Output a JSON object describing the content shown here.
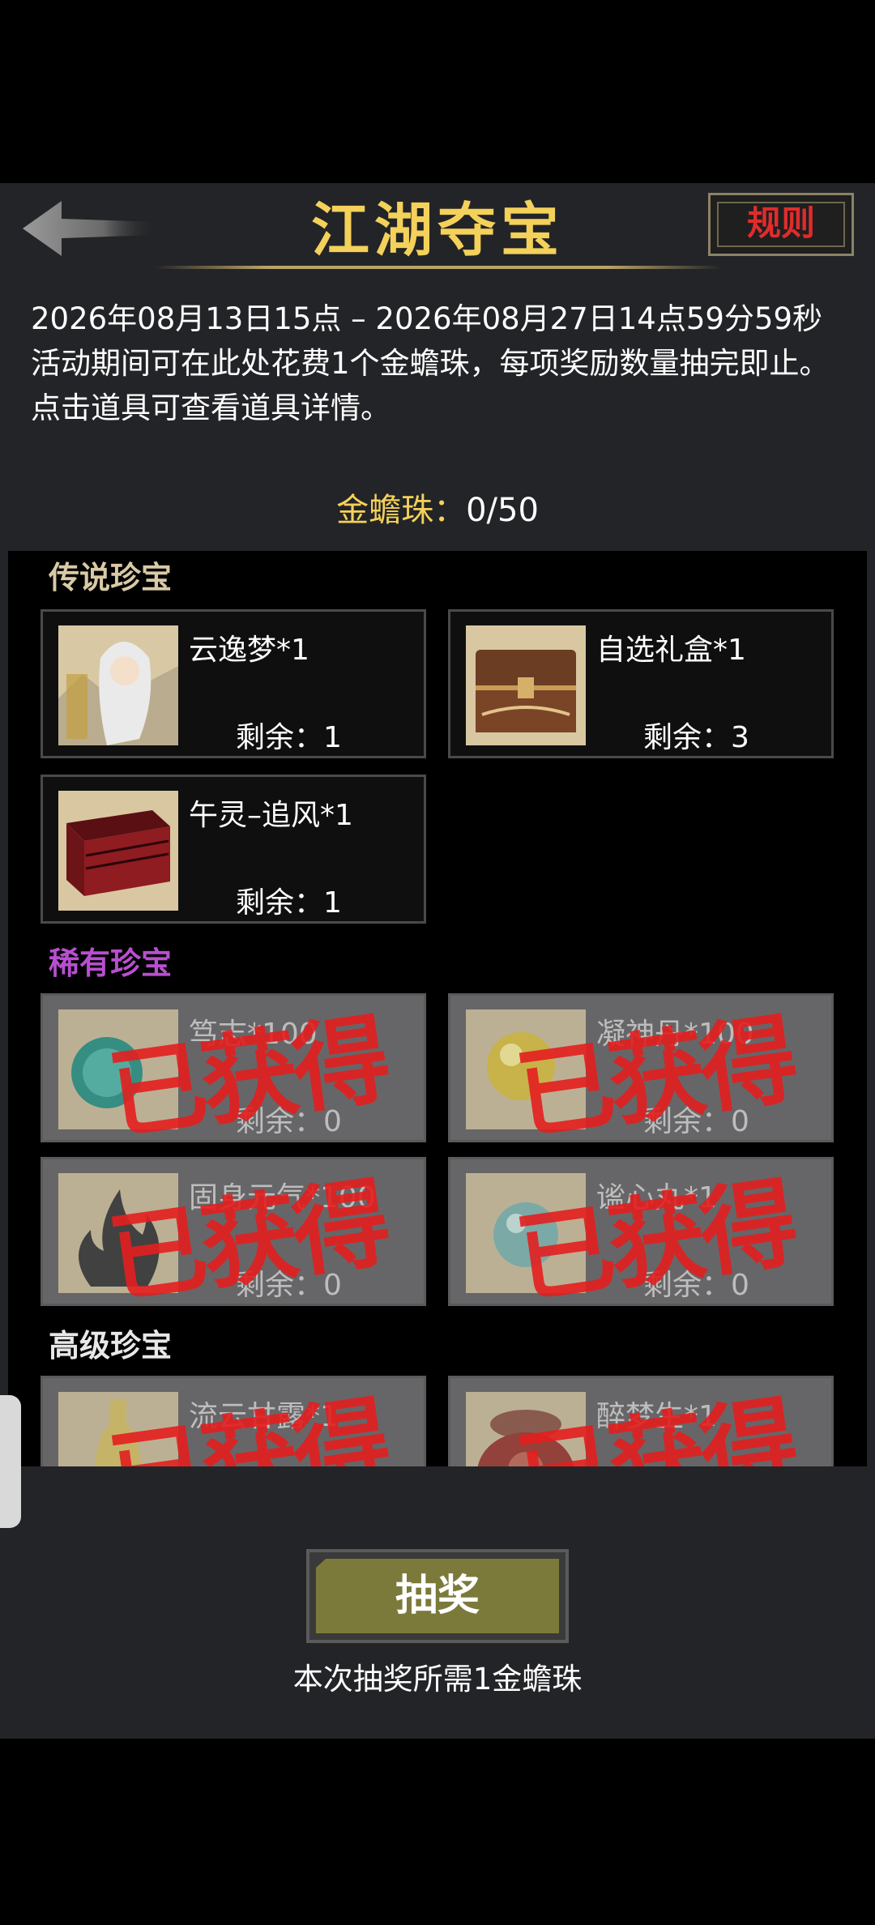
{
  "header": {
    "title": "江湖夺宝",
    "rules_label": "规则"
  },
  "description": {
    "period": "2026年08月13日15点 – 2026年08月27日14点59分59秒",
    "line2": "活动期间可在此处花费1个金蟾珠，每项奖励数量抽完即止。",
    "line3": "点击道具可查看道具详情。"
  },
  "currency": {
    "label": "金蟾珠：",
    "value": "0/50"
  },
  "sections": [
    {
      "title": "传说珍宝",
      "color": "#d9c9a6",
      "items": [
        {
          "name": "云逸梦*1",
          "remain": "剩余：1",
          "obtained": false,
          "icon": "character-portrait-icon"
        },
        {
          "name": "自选礼盒*1",
          "remain": "剩余：3",
          "obtained": false,
          "icon": "wooden-chest-icon"
        },
        {
          "name": "午灵–追风*1",
          "remain": "剩余：1",
          "obtained": false,
          "icon": "red-box-icon"
        }
      ]
    },
    {
      "title": "稀有珍宝",
      "color": "#b84fd0",
      "items": [
        {
          "name": "笃志*100",
          "remain": "剩余：0",
          "obtained": true,
          "icon": "teal-orb-icon"
        },
        {
          "name": "凝神丹*100",
          "remain": "剩余：0",
          "obtained": true,
          "icon": "gold-pill-icon"
        },
        {
          "name": "固身元气*100",
          "remain": "剩余：0",
          "obtained": true,
          "icon": "flame-icon"
        },
        {
          "name": "谧心丸*1",
          "remain": "剩余：0",
          "obtained": true,
          "icon": "cyan-pill-icon"
        }
      ]
    },
    {
      "title": "高级珍宝",
      "color": "#e8e8e8",
      "items": [
        {
          "name": "流云甘露*1",
          "remain": "",
          "obtained": true,
          "icon": "gourd-bottle-icon"
        },
        {
          "name": "醉梦生*1",
          "remain": "",
          "obtained": true,
          "icon": "wine-jar-icon"
        }
      ]
    }
  ],
  "stamp_text": "已获得",
  "draw": {
    "button_label": "抽奖",
    "cost_note": "本次抽奖所需1金蟾珠"
  }
}
